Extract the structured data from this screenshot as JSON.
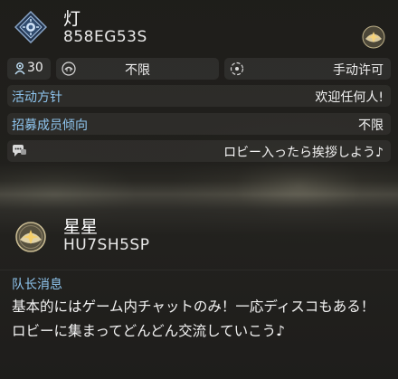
{
  "lobby": {
    "name": "灯",
    "code": "858EG53S",
    "member_count": "30",
    "permission_left": "不限",
    "permission_right": "手动许可",
    "policy_label": "活动方针",
    "policy_value": "欢迎任何人!",
    "tendency_label": "招募成员倾向",
    "tendency_value": "不限",
    "comment": "ロビー入ったら挨拶しよう♪"
  },
  "leader": {
    "name": "星星",
    "code": "HU7SH5SP",
    "message_label": "队长消息",
    "message": "基本的にはゲーム内チャットのみ！一応ディスコもある！ロビーに集まってどんどん交流していこう♪"
  },
  "colors": {
    "label_blue": "#8fc6f0",
    "emblem_blue": "#7aa8d8",
    "emblem_gold": "#d8c9a0"
  }
}
